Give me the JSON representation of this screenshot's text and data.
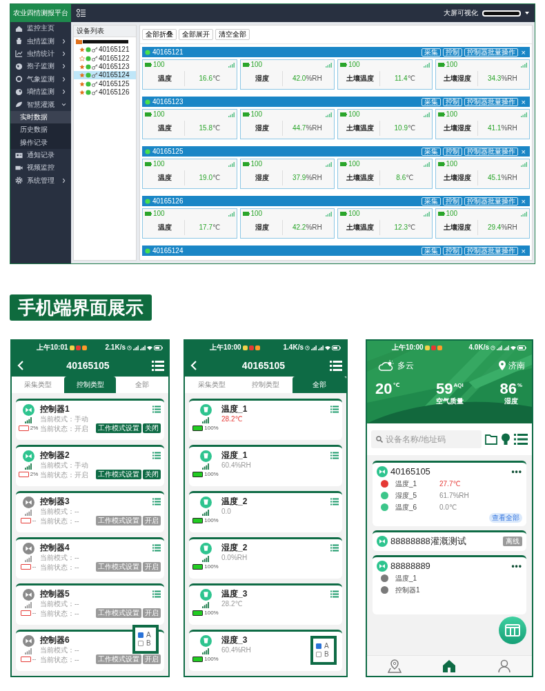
{
  "desktop": {
    "title": "农业四情测报平台",
    "sidebar": [
      {
        "label": "监控主页",
        "kind": "link",
        "selected": false
      },
      {
        "label": "虫情监测",
        "kind": "group",
        "expanded": false,
        "selected": false
      },
      {
        "label": "虫情统计",
        "kind": "group",
        "expanded": false,
        "selected": false
      },
      {
        "label": "孢子监测",
        "kind": "group",
        "expanded": false,
        "selected": false
      },
      {
        "label": "气象监测",
        "kind": "group",
        "expanded": false,
        "selected": false
      },
      {
        "label": "墒情监测",
        "kind": "group",
        "expanded": false,
        "selected": false
      },
      {
        "label": "智慧灌溉",
        "kind": "group",
        "expanded": true,
        "selected": false,
        "children": [
          {
            "label": "实时数据",
            "selected": true
          },
          {
            "label": "历史数据",
            "selected": false
          },
          {
            "label": "操作记录",
            "selected": false
          }
        ]
      },
      {
        "label": "通知记录",
        "kind": "link",
        "selected": false
      },
      {
        "label": "视频监控",
        "kind": "link",
        "selected": false
      },
      {
        "label": "系统管理",
        "kind": "group",
        "expanded": false,
        "selected": false
      }
    ],
    "topbar": {
      "link": "大屏可视化"
    },
    "tree": {
      "title": "设备列表",
      "children": [
        {
          "label": "40165121",
          "starred": true,
          "online": true,
          "selected": false
        },
        {
          "label": "40165122",
          "starred": false,
          "online": true,
          "selected": false
        },
        {
          "label": "40165123",
          "starred": true,
          "online": true,
          "selected": false
        },
        {
          "label": "40165124",
          "starred": true,
          "online": true,
          "selected": true
        },
        {
          "label": "40165125",
          "starred": true,
          "online": true,
          "selected": false
        },
        {
          "label": "40165126",
          "starred": true,
          "online": true,
          "selected": false
        }
      ]
    },
    "toolbar": [
      "全部折叠",
      "全部展开",
      "清空全部"
    ],
    "devices": [
      {
        "id": "40165121",
        "online": true,
        "actions": [
          "采集",
          "控制",
          "控制器批量操作"
        ],
        "close": "×",
        "sensors": [
          {
            "battery": "100",
            "label": "温度",
            "value": "16.6",
            "unit": "℃"
          },
          {
            "battery": "100",
            "label": "湿度",
            "value": "42.0",
            "unit": "%RH"
          },
          {
            "battery": "100",
            "label": "土壤温度",
            "value": "11.4",
            "unit": "℃"
          },
          {
            "battery": "100",
            "label": "土壤湿度",
            "value": "34.3",
            "unit": "%RH"
          }
        ]
      },
      {
        "id": "40165123",
        "online": true,
        "actions": [
          "采集",
          "控制",
          "控制器批量操作"
        ],
        "close": "×",
        "sensors": [
          {
            "battery": "100",
            "label": "温度",
            "value": "15.8",
            "unit": "℃"
          },
          {
            "battery": "100",
            "label": "湿度",
            "value": "44.7",
            "unit": "%RH"
          },
          {
            "battery": "100",
            "label": "土壤温度",
            "value": "10.9",
            "unit": "℃"
          },
          {
            "battery": "100",
            "label": "土壤湿度",
            "value": "41.1",
            "unit": "%RH"
          }
        ]
      },
      {
        "id": "40165125",
        "online": true,
        "actions": [
          "采集",
          "控制",
          "控制器批量操作"
        ],
        "close": "×",
        "sensors": [
          {
            "battery": "100",
            "label": "温度",
            "value": "19.0",
            "unit": "℃"
          },
          {
            "battery": "100",
            "label": "湿度",
            "value": "37.9",
            "unit": "%RH"
          },
          {
            "battery": "100",
            "label": "土壤温度",
            "value": "8.6",
            "unit": "℃"
          },
          {
            "battery": "100",
            "label": "土壤湿度",
            "value": "45.1",
            "unit": "%RH"
          }
        ]
      },
      {
        "id": "40165126",
        "online": true,
        "actions": [
          "采集",
          "控制",
          "控制器批量操作"
        ],
        "close": "×",
        "sensors": [
          {
            "battery": "100",
            "label": "温度",
            "value": "17.7",
            "unit": "℃"
          },
          {
            "battery": "100",
            "label": "湿度",
            "value": "42.2",
            "unit": "%RH"
          },
          {
            "battery": "100",
            "label": "土壤温度",
            "value": "12.3",
            "unit": "℃"
          },
          {
            "battery": "100",
            "label": "土壤湿度",
            "value": "29.4",
            "unit": "%RH"
          }
        ]
      },
      {
        "id": "40165124",
        "online": true,
        "actions": [
          "采集",
          "控制",
          "控制器批量操作"
        ],
        "close": "×"
      }
    ]
  },
  "section_heading": "手机端界面展示",
  "phones": [
    {
      "kind": "device_list",
      "status": {
        "time": "上午10:01",
        "speed": "2.1K/s"
      },
      "title": "40165105",
      "tabs": [
        {
          "label": "采集类型",
          "selected": false
        },
        {
          "label": "控制类型",
          "selected": true
        },
        {
          "label": "全部",
          "selected": false
        }
      ],
      "items": [
        {
          "kind": "controller",
          "name": "控制器1",
          "active": true,
          "mode": "当前模式：手动",
          "state": "当前状态：开启",
          "battery": "2%",
          "battery_low": true,
          "menu_icon": true,
          "buttons": [
            "工作模式设置",
            "关闭"
          ]
        },
        {
          "kind": "controller",
          "name": "控制器2",
          "active": true,
          "mode": "当前模式：手动",
          "state": "当前状态：开启",
          "battery": "2%",
          "battery_low": true,
          "menu_icon": true,
          "buttons": [
            "工作模式设置",
            "关闭"
          ]
        },
        {
          "kind": "controller",
          "name": "控制器3",
          "active": false,
          "mode": "当前模式：--",
          "state": "当前状态：--",
          "battery": "--",
          "battery_low": true,
          "menu_icon": true,
          "buttons": [
            "工作模式设置",
            "开启"
          ]
        },
        {
          "kind": "controller",
          "name": "控制器4",
          "active": false,
          "mode": "当前模式：--",
          "state": "当前状态：--",
          "battery": "--",
          "battery_low": true,
          "menu_icon": true,
          "buttons": [
            "工作模式设置",
            "开启"
          ]
        },
        {
          "kind": "controller",
          "name": "控制器5",
          "active": false,
          "mode": "当前模式：--",
          "state": "当前状态：--",
          "battery": "--",
          "battery_low": true,
          "menu_icon": true,
          "buttons": [
            "工作模式设置",
            "开启"
          ]
        },
        {
          "kind": "controller",
          "name": "控制器6",
          "active": false,
          "mode": "当前模式：--",
          "state": "当前状态：--",
          "battery": "--",
          "battery_low": true,
          "menu_icon": false,
          "buttons": [
            "工作模式设置",
            "开启"
          ]
        }
      ],
      "overlay": {
        "options": [
          {
            "label": "A",
            "checked": true
          },
          {
            "label": "B",
            "checked": false
          }
        ]
      }
    },
    {
      "kind": "device_list",
      "status": {
        "time": "上午10:00",
        "speed": "1.4K/s"
      },
      "title": "40165105",
      "tabs": [
        {
          "label": "采集类型",
          "selected": false
        },
        {
          "label": "控制类型",
          "selected": false
        },
        {
          "label": "全部",
          "selected": true
        }
      ],
      "items": [
        {
          "kind": "sensor",
          "name": "温度_1",
          "reading": "28.2℃",
          "alarm": true,
          "battery": "100%",
          "battery_low": false,
          "menu_icon": true
        },
        {
          "kind": "sensor",
          "name": "湿度_1",
          "reading": "60.4%RH",
          "alarm": false,
          "battery": "100%",
          "battery_low": false,
          "menu_icon": true
        },
        {
          "kind": "sensor",
          "name": "温度_2",
          "reading": "0.0",
          "alarm": false,
          "battery": "100%",
          "battery_low": false,
          "menu_icon": true
        },
        {
          "kind": "sensor",
          "name": "湿度_2",
          "reading": "0.0%RH",
          "alarm": false,
          "battery": "100%",
          "battery_low": false,
          "menu_icon": true
        },
        {
          "kind": "sensor",
          "name": "温度_3",
          "reading": "28.2℃",
          "alarm": false,
          "battery": "100%",
          "battery_low": false,
          "menu_icon": true
        },
        {
          "kind": "sensor",
          "name": "湿度_3",
          "reading": "60.4%RH",
          "alarm": false,
          "battery": "100%",
          "battery_low": false,
          "menu_icon": false
        }
      ],
      "overlay": {
        "options": [
          {
            "label": "A",
            "checked": true
          },
          {
            "label": "B",
            "checked": false
          }
        ]
      }
    },
    {
      "kind": "home",
      "status": {
        "time": "上午10:00",
        "speed": "4.0K/s"
      },
      "weather": {
        "condition": "多云",
        "city": "济南",
        "stats": [
          {
            "value": "20",
            "unit": "℃"
          },
          {
            "value": "59",
            "unit": "AQI",
            "label": "空气质量"
          },
          {
            "value": "86",
            "unit": "%",
            "label": "湿度"
          }
        ]
      },
      "search": {
        "placeholder": "设备名称/地址码"
      },
      "devices": [
        {
          "name": "40165105",
          "more": "•••",
          "points": [
            {
              "label": "温度_1",
              "reading": "27.7℃",
              "alarm": true,
              "color": "#e53935"
            },
            {
              "label": "湿度_5",
              "reading": "61.7%RH",
              "alarm": false,
              "color": "#3cc68a"
            },
            {
              "label": "温度_6",
              "reading": "0.0℃",
              "alarm": false,
              "color": "#3cc68a"
            }
          ],
          "view_all": "查看全部"
        },
        {
          "name": "88888888灌溉测试",
          "status": "离线"
        },
        {
          "name": "88888889",
          "more": "•••",
          "points": [
            {
              "label": "温度_1",
              "color": "#7a7a7a"
            },
            {
              "label": "控制器1",
              "color": "#7a7a7a"
            }
          ]
        }
      ],
      "nav": [
        {
          "selected": false
        },
        {
          "selected": true
        },
        {
          "selected": false
        }
      ]
    }
  ]
}
